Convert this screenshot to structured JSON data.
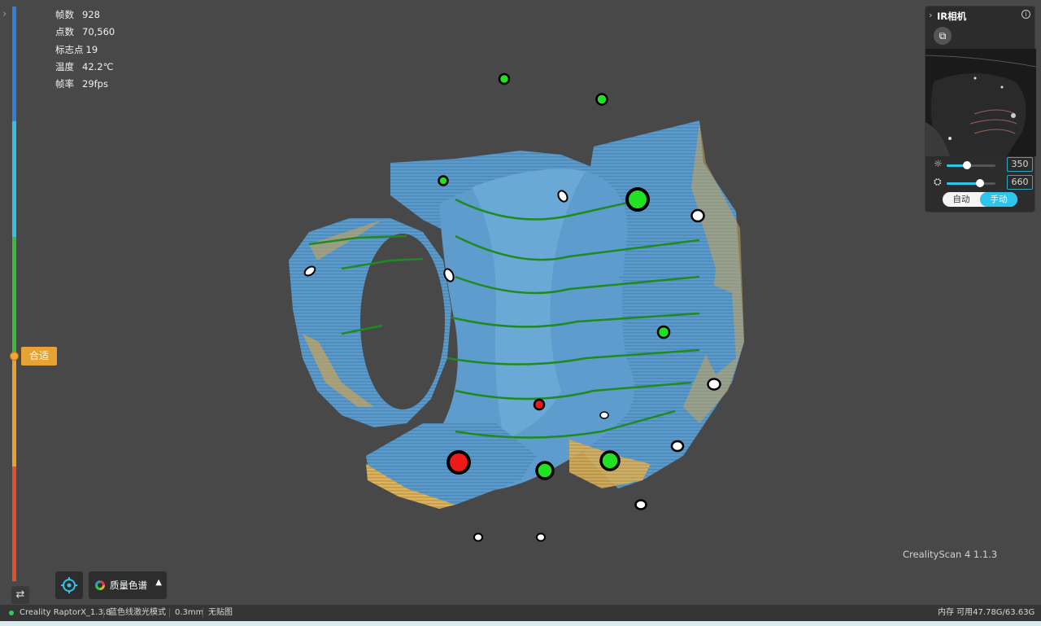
{
  "stats": [
    {
      "label": "帧数",
      "value": "928"
    },
    {
      "label": "点数",
      "value": "70,560"
    },
    {
      "label": "标志点",
      "value": "19"
    },
    {
      "label": "温度",
      "value": "42.2℃"
    },
    {
      "label": "帧率",
      "value": "29fps"
    }
  ],
  "scale": {
    "fit_label": "合适",
    "colors": {
      "far_blue": "#2f80d8",
      "cyan": "#36c0e6",
      "green": "#3cb83c",
      "orange": "#e8a030",
      "red": "#e0502c"
    }
  },
  "ir_camera": {
    "title": "IR相机",
    "brightness_value": "350",
    "brightness_level": 0.42,
    "exposure_value": "660",
    "exposure_level": 0.68,
    "mode_auto": "自动",
    "mode_manual": "手动",
    "selected_mode": "手动"
  },
  "version": "CrealityScan 4 1.1.3",
  "toolbar": {
    "quality_label": "质量色谱"
  },
  "statusbar": {
    "device": "Creality RaptorX_1.3.8",
    "mode": "蓝色线激光模式",
    "resolution": "0.3mm",
    "texture": "无贴图",
    "memory": "内存 可用47.78G/63.63G"
  },
  "colors": {
    "background": "#484848",
    "scan_blue": "#5a9ccd",
    "accent_cyan": "#2fc4ea",
    "marker_green": "#22e022",
    "marker_red": "#ee1a1a"
  }
}
